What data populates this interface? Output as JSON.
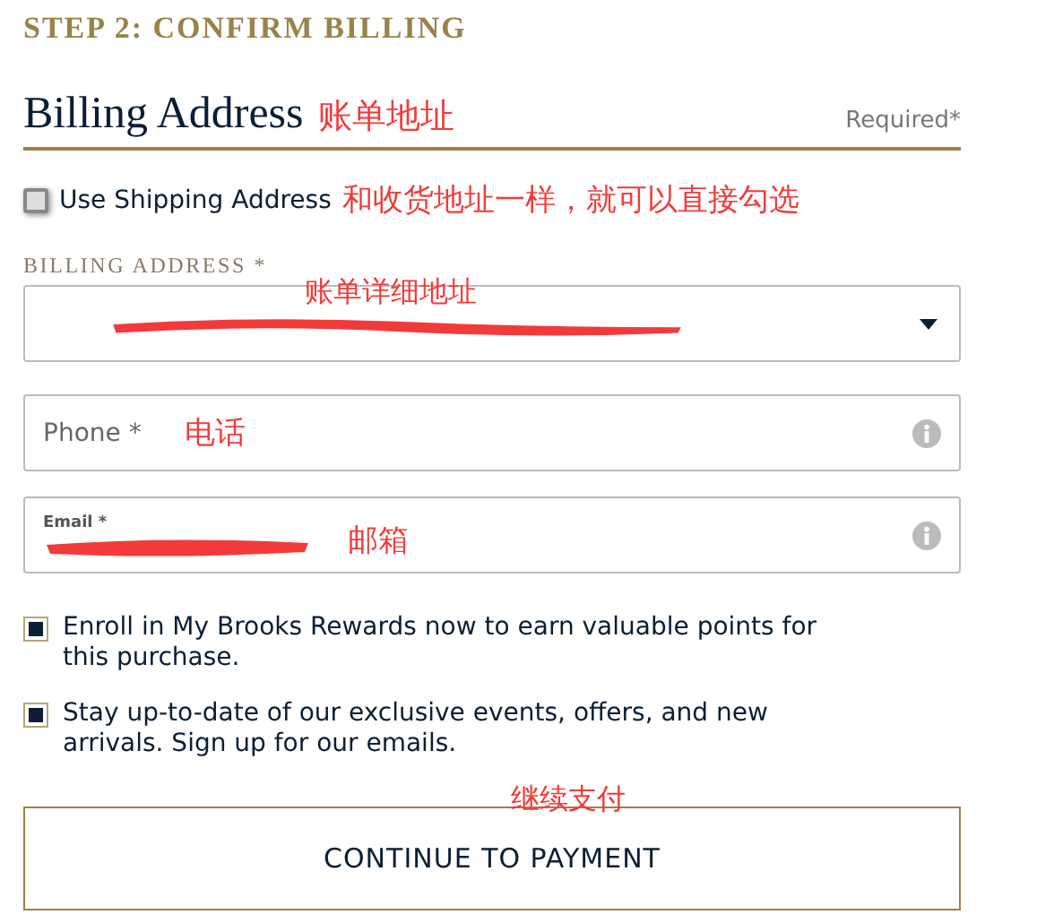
{
  "step_title": "STEP 2: CONFIRM BILLING",
  "section": {
    "title": "Billing Address",
    "required": "Required*"
  },
  "use_shipping": {
    "label": "Use Shipping Address",
    "checked": false
  },
  "address_select": {
    "label": "BILLING ADDRESS *",
    "redacted": true
  },
  "phone": {
    "placeholder": "Phone *"
  },
  "email": {
    "label": "Email *",
    "redacted": true
  },
  "options": [
    {
      "label": "Enroll in My Brooks Rewards now to earn valuable points for this purchase.",
      "checked": true
    },
    {
      "label": "Stay up-to-date of our exclusive events, offers, and new arrivals. Sign up for our emails.",
      "checked": true
    }
  ],
  "button": "CONTINUE TO PAYMENT",
  "annotations": {
    "section": "账单地址",
    "use_shipping": "和收货地址一样，就可以直接勾选",
    "address": "账单详细地址",
    "phone": "电话",
    "email": "邮箱",
    "button": "继续支付"
  }
}
